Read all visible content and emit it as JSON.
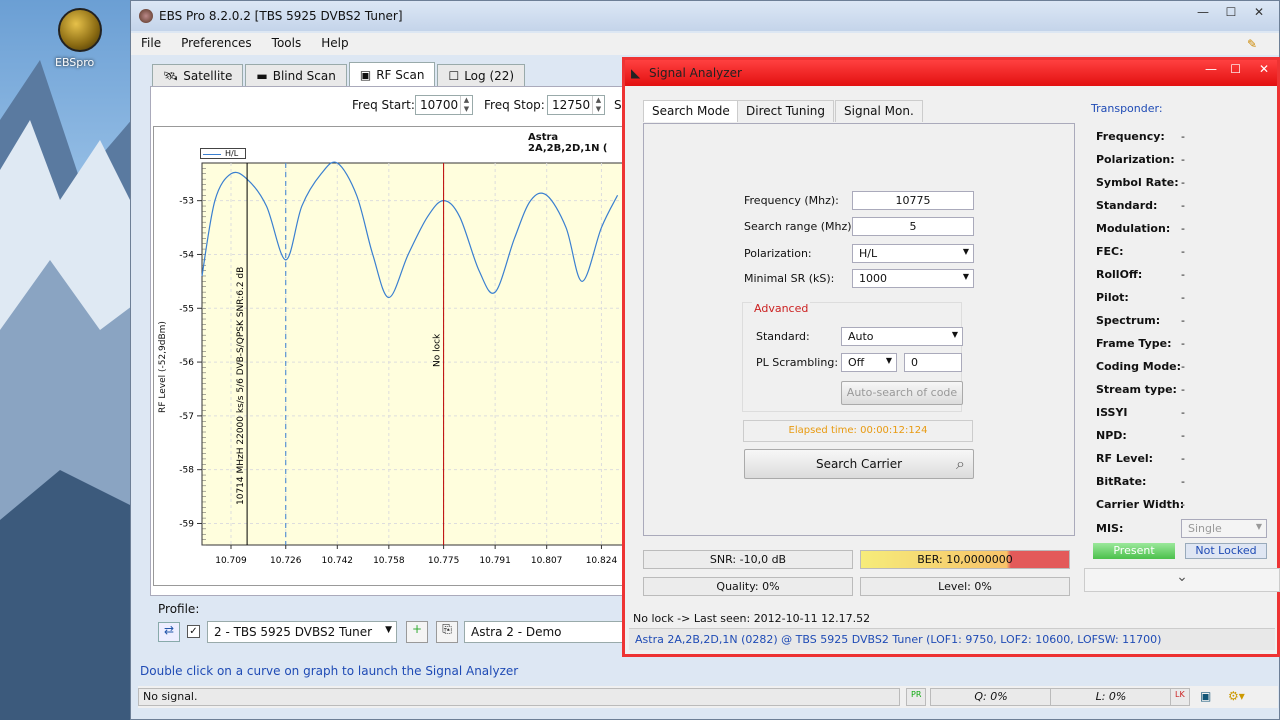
{
  "desktop": {
    "icon_label": "EBSpro"
  },
  "main_window": {
    "title": "EBS Pro 8.2.0.2 [TBS 5925 DVBS2 Tuner]",
    "menu": [
      "File",
      "Preferences",
      "Tools",
      "Help"
    ],
    "tabs": [
      "Satellite",
      "Blind Scan",
      "RF Scan",
      "Log (22)"
    ],
    "freq_start_label": "Freq Start:",
    "freq_start_value": "10700",
    "freq_stop_label": "Freq Stop:",
    "freq_stop_value": "12750",
    "chart_title": "Astra 2A,2B,2D,1N (",
    "legend": "H/L",
    "marker_label": "10714 MHzH 22000 ks/s 5/6 DVB-S/QPSK SNR:6.2 dB",
    "nolock_label": "No lock",
    "profile_label": "Profile:",
    "profile_value": "2 - TBS 5925 DVBS2 Tuner",
    "sat_value": "Astra 2 - Demo",
    "hint": "Double click on a curve on graph to launch the Signal Analyzer",
    "status_text": "No signal.",
    "status_pr": "PR",
    "status_q": "Q: 0%",
    "status_l": "L: 0%",
    "status_lk": "LK"
  },
  "chart_data": {
    "type": "line",
    "xlabel": "",
    "ylabel": "RF Level (-52,9dBm)",
    "x_ticks": [
      "10.709",
      "10.726",
      "10.742",
      "10.758",
      "10.775",
      "10.791",
      "10.807",
      "10.824"
    ],
    "y_ticks": [
      "-53",
      "-54",
      "-55",
      "-56",
      "-57",
      "-58",
      "-59"
    ],
    "ylim": [
      -59.4,
      -52.3
    ],
    "series": [
      {
        "name": "H/L",
        "x": [
          10.7,
          10.704,
          10.709,
          10.714,
          10.72,
          10.726,
          10.731,
          10.737,
          10.742,
          10.748,
          10.753,
          10.758,
          10.764,
          10.77,
          10.775,
          10.78,
          10.786,
          10.791,
          10.797,
          10.802,
          10.807,
          10.813,
          10.818,
          10.824,
          10.829
        ],
        "values": [
          -54.4,
          -53.0,
          -52.5,
          -52.6,
          -53.1,
          -54.1,
          -53.1,
          -52.5,
          -52.3,
          -52.9,
          -54.0,
          -54.8,
          -54.0,
          -53.3,
          -53.0,
          -53.3,
          -54.3,
          -54.7,
          -53.7,
          -53.0,
          -52.9,
          -53.5,
          -54.5,
          -53.5,
          -52.9
        ]
      }
    ]
  },
  "signal_analyzer": {
    "title": "Signal Analyzer",
    "tabs": [
      "Search Mode",
      "Direct Tuning",
      "Signal Mon."
    ],
    "frequency_label": "Frequency (Mhz):",
    "frequency_value": "10775",
    "search_range_label": "Search range (Mhz):",
    "search_range_value": "5",
    "polarization_label": "Polarization:",
    "polarization_value": "H/L",
    "minimal_sr_label": "Minimal SR (kS):",
    "minimal_sr_value": "1000",
    "advanced_label": "Advanced",
    "standard_label": "Standard:",
    "standard_value": "Auto",
    "pl_label": "PL Scrambling:",
    "pl_value": "Off",
    "pl_code": "0",
    "auto_search": "Auto-search of code",
    "elapsed": "Elapsed time: 00:00:12:124",
    "search_btn": "Search Carrier",
    "snr": "SNR: -10,0 dB",
    "ber": "BER: 10,0000000",
    "quality": "Quality: 0%",
    "level": "Level: 0%",
    "status1": "No lock -> Last seen: 2012-10-11 12.17.52",
    "status2": "Astra 2A,2B,2D,1N (0282) @ TBS 5925 DVBS2 Tuner (LOF1: 9750, LOF2: 10600, LOFSW: 11700)",
    "transponder_title": "Transponder:",
    "transponder": [
      {
        "label": "Frequency:",
        "value": "-"
      },
      {
        "label": "Polarization:",
        "value": "-"
      },
      {
        "label": "Symbol Rate:",
        "value": "-"
      },
      {
        "label": "Standard:",
        "value": "-"
      },
      {
        "label": "Modulation:",
        "value": "-"
      },
      {
        "label": "FEC:",
        "value": "-"
      },
      {
        "label": "RollOff:",
        "value": "-"
      },
      {
        "label": "Pilot:",
        "value": "-"
      },
      {
        "label": "Spectrum:",
        "value": "-"
      },
      {
        "label": "Frame Type:",
        "value": "-"
      },
      {
        "label": "Coding Mode:",
        "value": "-"
      },
      {
        "label": "Stream type:",
        "value": "-"
      },
      {
        "label": "ISSYI",
        "value": "-"
      },
      {
        "label": "NPD:",
        "value": "-"
      },
      {
        "label": "RF Level:",
        "value": "-"
      },
      {
        "label": "BitRate:",
        "value": "-"
      },
      {
        "label": "Carrier Width:",
        "value": "-"
      }
    ],
    "mis_label": "MIS:",
    "mis_value": "Single",
    "present": "Present",
    "not_locked": "Not Locked"
  }
}
